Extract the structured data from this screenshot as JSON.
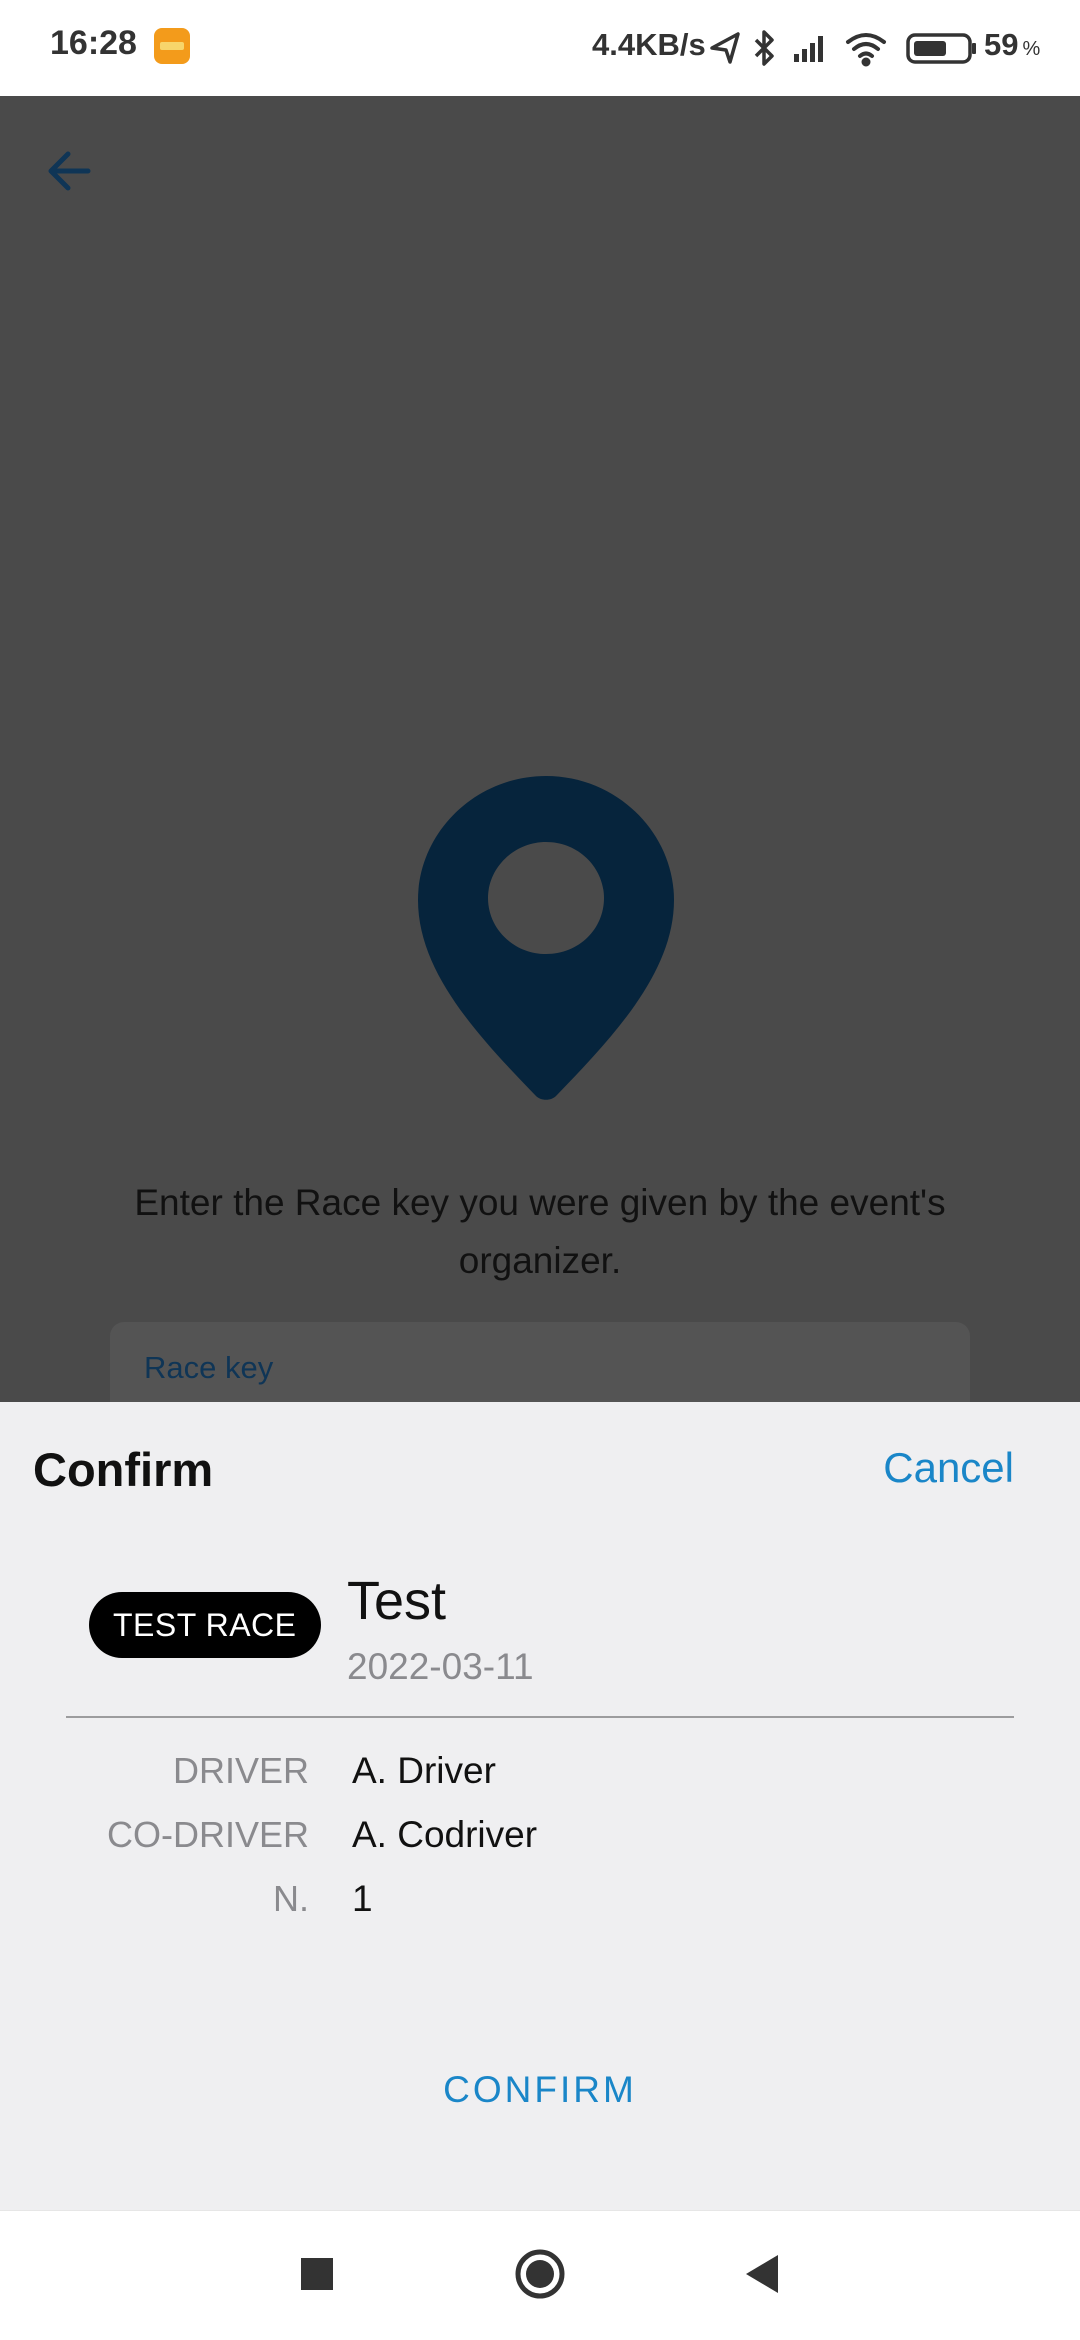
{
  "status_bar": {
    "time": "16:28",
    "net_speed": "4.4KB/s",
    "battery_level": "59",
    "battery_unit": "%",
    "icons": [
      "app-notification-icon",
      "location-icon",
      "bluetooth-icon",
      "signal-icon",
      "wifi-icon",
      "battery-icon"
    ]
  },
  "background_page": {
    "instruction": "Enter the Race key you were given by the event's organizer.",
    "race_key_label": "Race key",
    "icons": [
      "back-arrow-icon",
      "map-pin-icon",
      "key-input-icon"
    ]
  },
  "confirm_sheet": {
    "title": "Confirm",
    "cancel_label": "Cancel",
    "race_badge": "TEST RACE",
    "race_name": "Test",
    "race_date": "2022-03-11",
    "details": [
      {
        "label": "DRIVER",
        "value": "A. Driver"
      },
      {
        "label": "CO-DRIVER",
        "value": "A. Codriver"
      },
      {
        "label": "N.",
        "value": "1"
      }
    ],
    "confirm_label": "CONFIRM"
  },
  "nav_bar": {
    "icons": [
      "recents-square-icon",
      "home-circle-icon",
      "back-triangle-icon"
    ]
  },
  "colors": {
    "accent": "#1a86c8",
    "overlay": "#4a4a4a",
    "pin": "#06243c",
    "sheet": "#efeff1"
  }
}
